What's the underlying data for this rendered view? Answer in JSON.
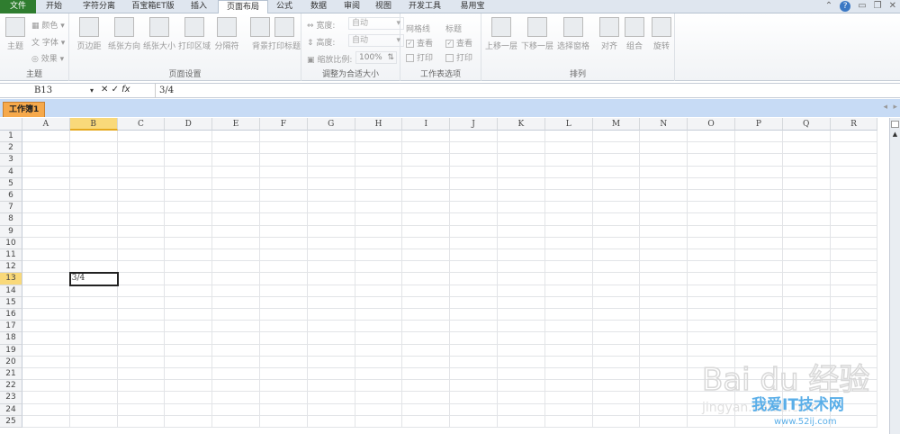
{
  "ribbon_tabs": [
    "文件",
    "开始",
    "字符分离",
    "百宝箱ET版",
    "插入",
    "页面布局",
    "公式",
    "数据",
    "审阅",
    "视图",
    "开发工具",
    "易用宝"
  ],
  "active_tab": "页面布局",
  "groups": {
    "theme": {
      "label": "主题",
      "theme": "主题",
      "colors": "颜色",
      "fonts": "字体",
      "effects": "效果"
    },
    "page_setup": {
      "label": "页面设置",
      "buttons": [
        "页边距",
        "纸张方向",
        "纸张大小",
        "打印区域",
        "分隔符",
        "背景",
        "打印标题"
      ]
    },
    "scale": {
      "label": "调整为合适大小",
      "width_label": "宽度:",
      "width_value": "自动",
      "height_label": "高度:",
      "height_value": "自动",
      "scale_label": "缩放比例:",
      "scale_value": "100%"
    },
    "sheet_options": {
      "label": "工作表选项",
      "gridlines": "网格线",
      "headings": "标题",
      "view": "查看",
      "print": "打印"
    },
    "arrange": {
      "label": "排列",
      "buttons": [
        "上移一层",
        "下移一层",
        "选择窗格",
        "对齐",
        "组合",
        "旋转"
      ]
    }
  },
  "formula_bar": {
    "name_box": "B13",
    "fx": "fx",
    "value": "3/4"
  },
  "workbook_tab": "工作簿1",
  "columns": [
    "A",
    "B",
    "C",
    "D",
    "E",
    "F",
    "G",
    "H",
    "I",
    "J",
    "K",
    "L",
    "M",
    "N",
    "O",
    "P",
    "Q",
    "R"
  ],
  "rows": [
    "1",
    "2",
    "3",
    "4",
    "5",
    "6",
    "7",
    "8",
    "9",
    "10",
    "11",
    "12",
    "13",
    "14",
    "15",
    "16",
    "17",
    "18",
    "19",
    "20",
    "21",
    "22",
    "23",
    "24",
    "25"
  ],
  "selected_cell": {
    "col": "B",
    "row": "13",
    "value": "3/4"
  },
  "watermark": {
    "text1": "Bai du 经验",
    "text2": "jingyan.baidu.com",
    "text3": "我爱IT技术网",
    "text4": "www.52ij.com"
  }
}
